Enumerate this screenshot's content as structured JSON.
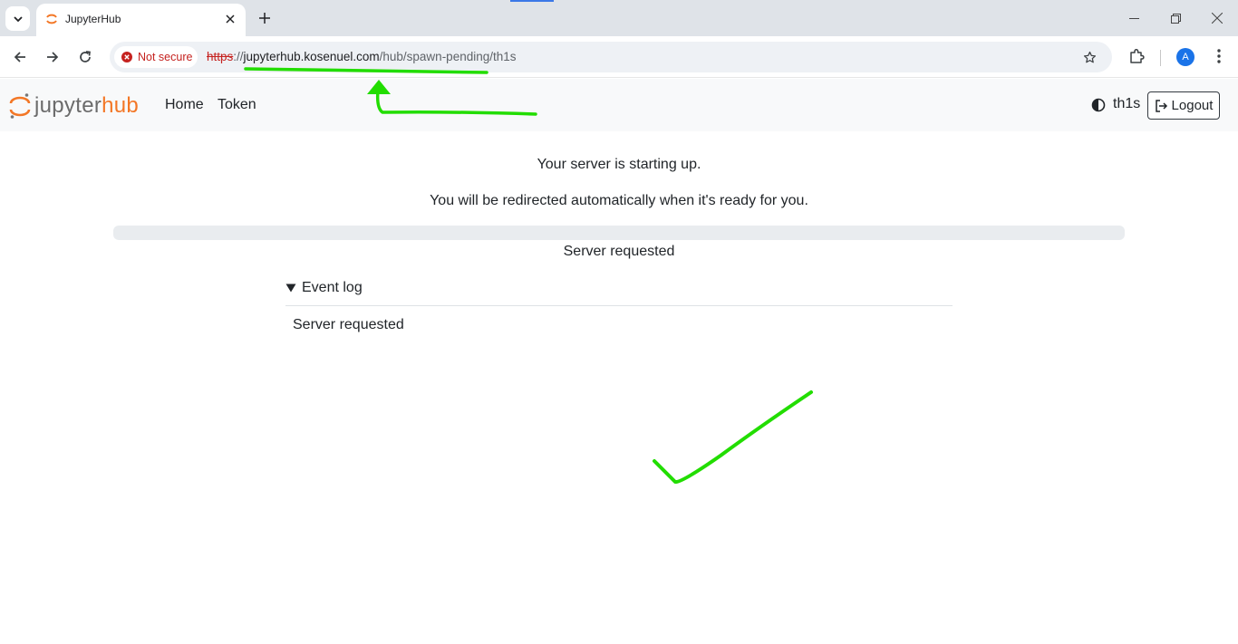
{
  "browser": {
    "tab_title": "JupyterHub",
    "security_label": "Not secure",
    "url_scheme": "https",
    "url_sep": "://",
    "url_host": "jupyterhub.kosenuel.com",
    "url_path": "/hub/spawn-pending/th1s",
    "profile_initial": "A"
  },
  "navbar": {
    "logo_part1": "jupyter",
    "logo_part2": "hub",
    "links": [
      "Home",
      "Token"
    ],
    "user": "th1s",
    "logout_label": "Logout"
  },
  "main": {
    "starting_msg": "Your server is starting up.",
    "redirect_msg": "You will be redirected automatically when it's ready for you.",
    "progress_fraction": 0,
    "progress_message": "Server requested",
    "event_log_label": "Event log",
    "events": [
      "Server requested"
    ]
  },
  "colors": {
    "brand_orange": "#f37726",
    "annotation_green": "#22dd00",
    "insecure_red": "#c5221f"
  },
  "icons": [
    "chevron-down-icon",
    "jupyter-favicon",
    "close-icon",
    "plus-icon",
    "minimize-icon",
    "restore-icon",
    "back-arrow-icon",
    "forward-arrow-icon",
    "reload-icon",
    "warning-icon",
    "star-icon",
    "extensions-icon",
    "kebab-menu-icon",
    "theme-toggle-icon",
    "logout-icon",
    "triangle-down-icon"
  ]
}
